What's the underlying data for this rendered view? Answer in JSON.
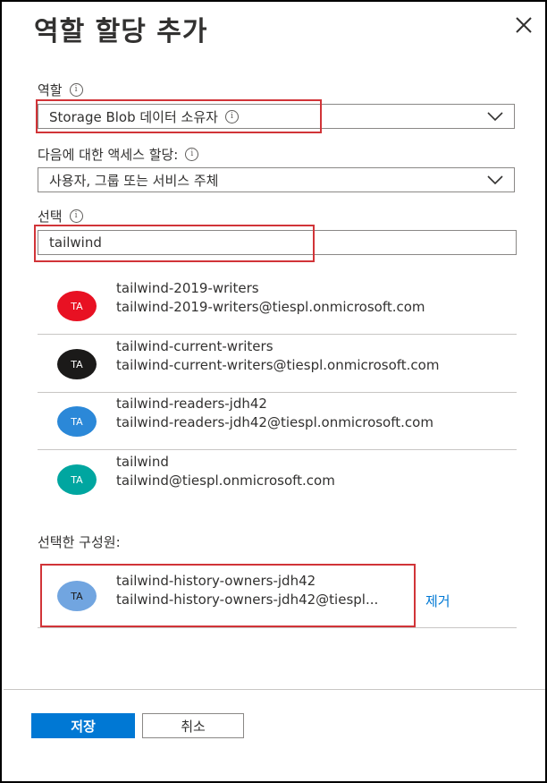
{
  "panel": {
    "title": "역할 할당 추가"
  },
  "role": {
    "label": "역할",
    "value": "Storage Blob 데이터 소유자"
  },
  "assign_access": {
    "label": "다음에 대한 액세스 할당:",
    "value": "사용자, 그룹 또는 서비스 주체"
  },
  "select": {
    "label": "선택",
    "value": "tailwind"
  },
  "results": [
    {
      "initials": "TA",
      "color": "#e81123",
      "name": "tailwind-2019-writers",
      "email": "tailwind-2019-writers@tiespl.onmicrosoft.com"
    },
    {
      "initials": "TA",
      "color": "#1b1a19",
      "name": "tailwind-current-writers",
      "email": "tailwind-current-writers@tiespl.onmicrosoft.com"
    },
    {
      "initials": "TA",
      "color": "#2b88d8",
      "name": "tailwind-readers-jdh42",
      "email": "tailwind-readers-jdh42@tiespl.onmicrosoft.com"
    },
    {
      "initials": "TA",
      "color": "#00a6a0",
      "name": "tailwind",
      "email": "tailwind@tiespl.onmicrosoft.com"
    }
  ],
  "selected_members": {
    "label": "선택한 구성원:",
    "items": [
      {
        "initials": "TA",
        "color": "#71a5e0",
        "name": "tailwind-history-owners-jdh42",
        "email": "tailwind-history-owners-jdh42@tiespl...",
        "remove_label": "제거"
      }
    ]
  },
  "footer": {
    "save_label": "저장",
    "cancel_label": "취소"
  },
  "colors": {
    "highlight": "#d13438",
    "primary": "#0078d4"
  },
  "icons": {
    "info": "i"
  }
}
